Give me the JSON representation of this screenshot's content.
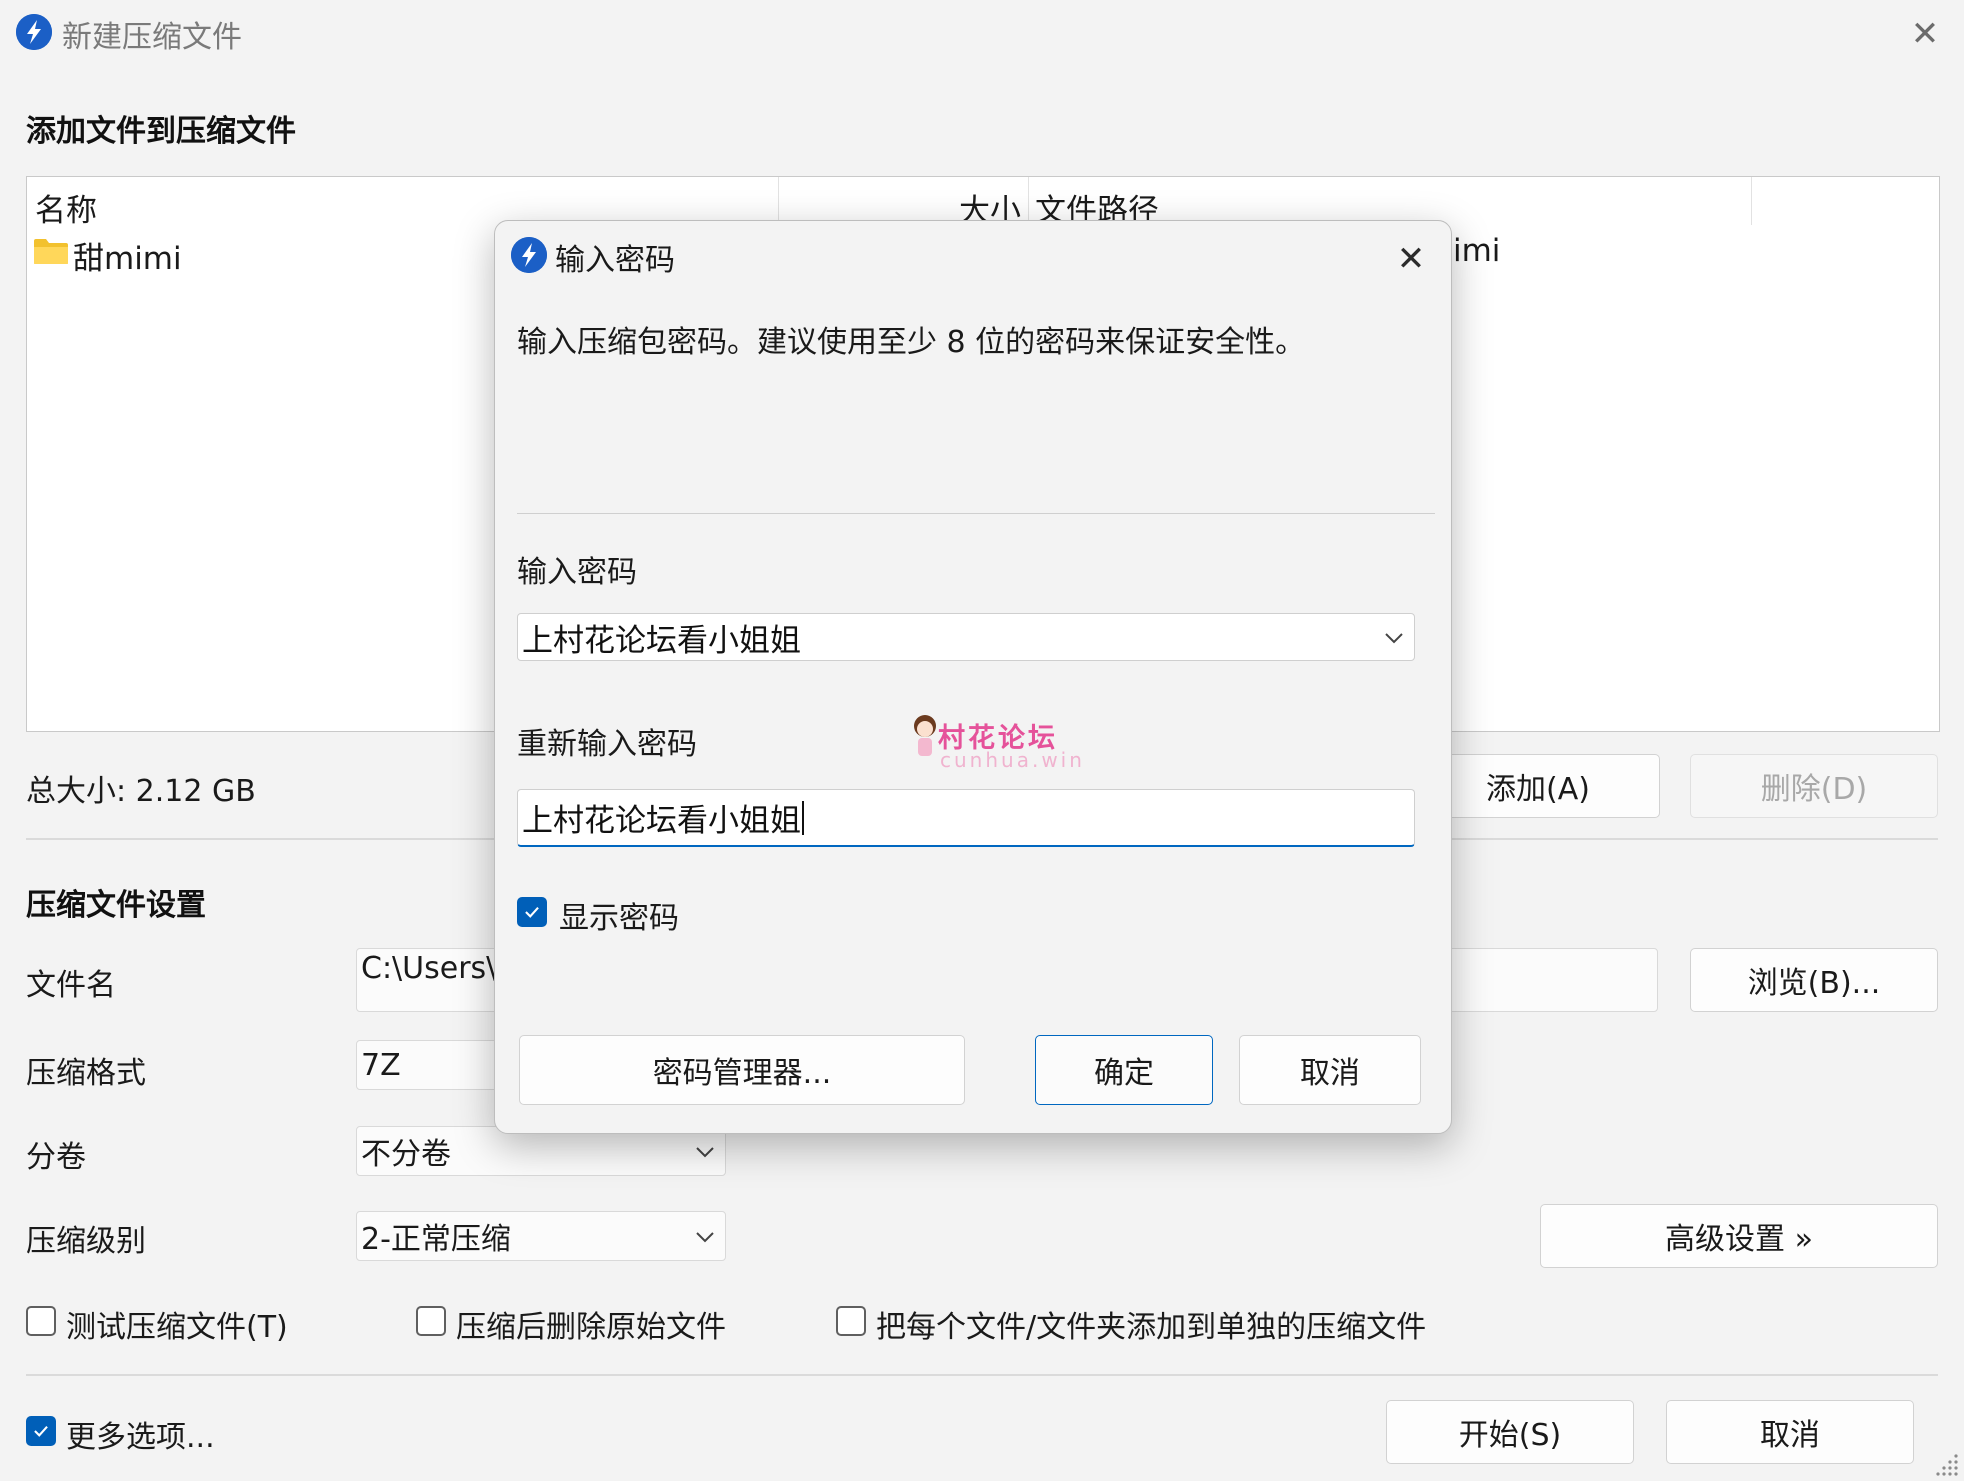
{
  "window": {
    "title": "新建压缩文件",
    "close_glyph": "✕"
  },
  "files_section": {
    "heading": "添加文件到压缩文件",
    "columns": [
      "名称",
      "大小",
      "文件路径"
    ],
    "rows": [
      {
        "name": "甜mimi",
        "icon": "folder-icon",
        "path_visible": "imi"
      }
    ],
    "total_size": "总大小: 2.12 GB",
    "add_button": "添加(A)",
    "delete_button": "删除(D)"
  },
  "settings_section": {
    "heading": "压缩文件设置",
    "filename_label": "文件名",
    "filename_value": "C:\\Users\\",
    "browse_button": "浏览(B)...",
    "format_label": "压缩格式",
    "format_value": "7Z",
    "split_label": "分卷",
    "split_value": "不分卷",
    "level_label": "压缩级别",
    "level_value": "2-正常压缩",
    "advanced_button": "高级设置 »",
    "options": [
      {
        "label": "测试压缩文件(T)",
        "checked": false
      },
      {
        "label": "压缩后删除原始文件",
        "checked": false
      },
      {
        "label": "把每个文件/文件夹添加到单独的压缩文件",
        "checked": false
      }
    ],
    "more_options": {
      "label": "更多选项...",
      "checked": true
    },
    "start_button": "开始(S)",
    "cancel_button": "取消"
  },
  "dialog": {
    "title": "输入密码",
    "close_glyph": "✕",
    "description": "输入压缩包密码。建议使用至少 8 位的密码来保证安全性。",
    "password_label": "输入密码",
    "password_value": "上村花论坛看小姐姐",
    "confirm_label": "重新输入密码",
    "confirm_value": "上村花论坛看小姐姐",
    "show_password": {
      "label": "显示密码",
      "checked": true
    },
    "manager_button": "密码管理器...",
    "ok_button": "确定",
    "cancel_button": "取消"
  },
  "watermark": {
    "text": "村花论坛",
    "sub": "cunhua.win"
  },
  "colors": {
    "accent": "#005fb8",
    "app_icon": "#1b5fc6",
    "watermark": "#e5529a"
  }
}
